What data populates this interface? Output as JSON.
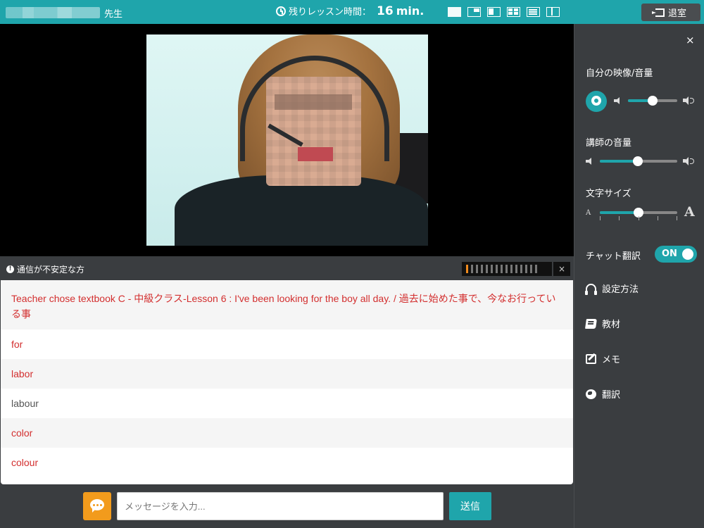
{
  "header": {
    "teacher_suffix": "先生",
    "timer_label": "残りレッスン時間：",
    "timer_value": "16",
    "timer_unit": "min.",
    "layout_buttons": [
      "layout-video-only",
      "layout-pip",
      "layout-split-left",
      "layout-grid",
      "layout-text",
      "layout-split-columns"
    ],
    "exit_label": "退室"
  },
  "notice": {
    "text": "通信が不安定な方",
    "signal_bars_total": 15,
    "signal_bars_active": 1,
    "close_label": "×"
  },
  "chat": {
    "messages": [
      {
        "text": "Teacher chose textbook C - 中級クラス-Lesson 6 : I've been looking for the boy all day. / 過去に始めた事で、今なお行っている事",
        "color": "red"
      },
      {
        "text": "for",
        "color": "red"
      },
      {
        "text": "labor",
        "color": "red"
      },
      {
        "text": "labour",
        "color": "gray"
      },
      {
        "text": "color",
        "color": "red"
      },
      {
        "text": "colour",
        "color": "red"
      }
    ]
  },
  "input": {
    "placeholder": "メッセージを入力...",
    "send_label": "送信"
  },
  "sidebar": {
    "close_label": "×",
    "own_video_label": "自分の映像/音量",
    "own_volume": 0.5,
    "teacher_volume_label": "講師の音量",
    "teacher_volume": 0.49,
    "font_size_label": "文字サイズ",
    "font_size_small_glyph": "A",
    "font_size_large_glyph": "A",
    "font_size_level": 0.5,
    "chat_translate_label": "チャット翻訳",
    "chat_translate_state": "ON",
    "menu": [
      {
        "icon": "headphones-icon",
        "label": "設定方法"
      },
      {
        "icon": "book-icon",
        "label": "教材"
      },
      {
        "icon": "edit-icon",
        "label": "メモ"
      },
      {
        "icon": "globe-icon",
        "label": "翻訳"
      }
    ]
  },
  "colors": {
    "accent": "#1fa5ab",
    "chat_text": "#d32f2f",
    "orange": "#f29b1c",
    "panel": "#3a3d40"
  }
}
